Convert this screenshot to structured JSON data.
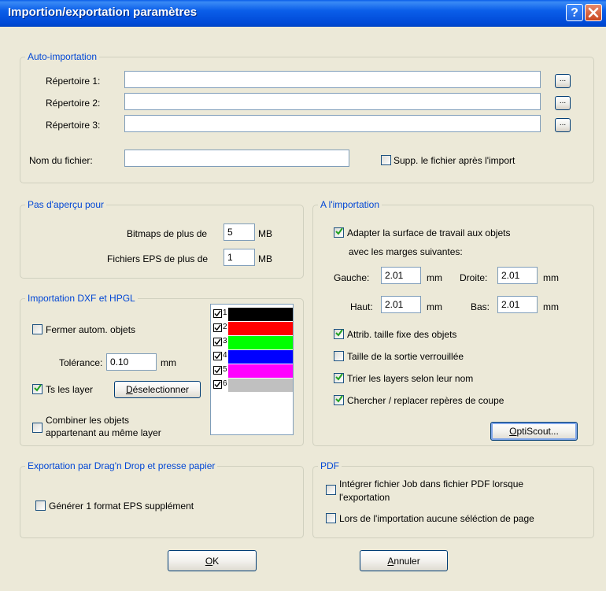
{
  "window": {
    "title": "Importion/exportation paramètres",
    "help_icon": "question-icon",
    "close_icon": "close-icon"
  },
  "auto_import": {
    "legend": "Auto-importation",
    "dir1_label": "Répertoire 1:",
    "dir2_label": "Répertoire 2:",
    "dir3_label": "Répertoire 3:",
    "dir1_value": "",
    "dir2_value": "",
    "dir3_value": "",
    "browse_label": "...",
    "filename_label": "Nom du fichier:",
    "filename_value": "",
    "delete_after_import_label": "Supp. le fichier après l'import",
    "delete_after_import_checked": false
  },
  "preview": {
    "legend": "Pas d'aperçu pour",
    "bitmaps_label": "Bitmaps de plus de",
    "bitmaps_value": "5",
    "bitmaps_unit": "MB",
    "eps_label": "Fichiers EPS de plus de",
    "eps_value": "1",
    "eps_unit": "MB"
  },
  "dxf": {
    "legend": "Importation DXF et HPGL",
    "close_objects_label": "Fermer autom. objets",
    "close_objects_checked": false,
    "tolerance_label": "Tolérance:",
    "tolerance_value": "0.10",
    "tolerance_unit": "mm",
    "all_layers_label": "Ts les layer",
    "all_layers_checked": true,
    "deselect_label": "Déselectionner",
    "combine_label_1": "Combiner les objets",
    "combine_label_2": "appartenant au même layer",
    "combine_checked": false,
    "layers": [
      {
        "num": "1",
        "color": "#000000",
        "checked": true
      },
      {
        "num": "2",
        "color": "#ff0000",
        "checked": true
      },
      {
        "num": "3",
        "color": "#00ff00",
        "checked": true
      },
      {
        "num": "4",
        "color": "#0000ff",
        "checked": true
      },
      {
        "num": "5",
        "color": "#ff00ff",
        "checked": true
      },
      {
        "num": "6",
        "color": "#c0c0c0",
        "checked": true
      }
    ]
  },
  "import": {
    "legend": "A l'importation",
    "adapt_label_1": "Adapter la surface de travail aux objets",
    "adapt_label_2": "avec les marges suivantes:",
    "adapt_checked": true,
    "left_label": "Gauche:",
    "left_value": "2.01",
    "right_label": "Droite:",
    "right_value": "2.01",
    "top_label": "Haut:",
    "top_value": "2.01",
    "bottom_label": "Bas:",
    "bottom_value": "2.01",
    "unit": "mm",
    "fixed_size_label": "Attrib. taille fixe des objets",
    "fixed_size_checked": true,
    "locked_output_label": "Taille de la sortie verrouillée",
    "locked_output_checked": false,
    "sort_layers_label": "Trier les layers selon leur nom",
    "sort_layers_checked": true,
    "cut_marks_label": "Chercher / replacer repères de coupe",
    "cut_marks_checked": true,
    "optiscout_label": "OptiScout..."
  },
  "export": {
    "legend": "Exportation par Drag'n Drop et presse papier",
    "eps_label": "Générer 1 format EPS supplément",
    "eps_checked": false
  },
  "pdf": {
    "legend": "PDF",
    "job_label_1": "Intégrer fichier Job dans fichier PDF lorsque",
    "job_label_2": "l'exportation",
    "job_checked": false,
    "no_page_select_label": "Lors de l'importation aucune séléction de page",
    "no_page_select_checked": false
  },
  "footer": {
    "ok_label": "OK",
    "cancel_label": "Annuler"
  }
}
